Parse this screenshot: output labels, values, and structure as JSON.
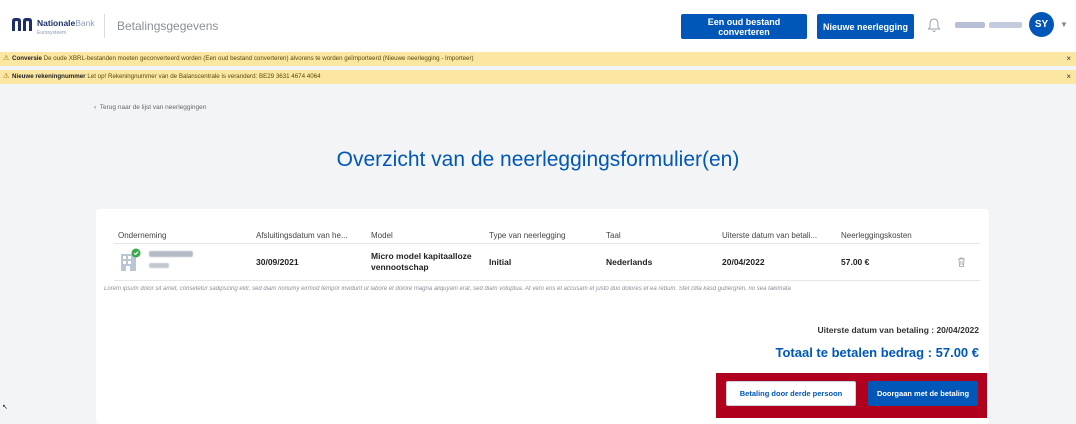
{
  "header": {
    "logo_name_bold": "Nationale",
    "logo_name_light": "Bank",
    "logo_sub": "Eurosysteem",
    "app_title": "Betalingsgegevens",
    "convert_button": "Een oud bestand converteren",
    "new_filing_button": "Nieuwe neerlegging",
    "avatar_initials": "SY",
    "colors": {
      "primary": "#0057b8",
      "alert_bg": "#fbe6a2",
      "highlight": "#b0001e"
    }
  },
  "alerts": [
    {
      "title": "Conversie",
      "text": "De oude XBRL-bestanden moeten geconverteerd worden (Een oud bestand converteren) alvorens te worden geïmporteerd (Nieuwe neerlegging - Importeer)",
      "close": "×"
    },
    {
      "title": "Nieuwe rekeningnummer",
      "text": "Let op! Rekeningnummer van de Balanscentrale is veranderd: BE29 3631 4674 4064",
      "close": "×"
    }
  ],
  "back_link": "Terug naar de lijst van neerleggingen",
  "page_title": "Overzicht van de neerleggingsformulier(en)",
  "table": {
    "columns": [
      "Onderneming",
      "Afsluitingsdatum van he...",
      "Model",
      "Type van neerlegging",
      "Taal",
      "Uiterste datum van betali...",
      "Neerleggingskosten"
    ],
    "row": {
      "closing_date": "30/09/2021",
      "model_line1": "Micro model kapitaalloze",
      "model_line2": "vennootschap",
      "type": "Initial",
      "language": "Nederlands",
      "due_date": "20/04/2022",
      "cost": "57.00 €"
    },
    "note": "Lorem ipsum dolor sit amet, consetetur sadipscing elitr, sed diam nonumy eirmod tempor invidunt ut labore et dolore magna aliquyam erat, sed diam voluptua. At vero eos et accusam et justo duo dolores et ea rebum. Stet clita kasd gubergren, no sea takimata"
  },
  "summary": {
    "due_line": "Uiterste datum van betaling : 20/04/2022",
    "total_line": "Totaal te betalen bedrag : 57.00 €"
  },
  "actions": {
    "third_party": "Betaling door derde persoon",
    "continue": "Doorgaan met de betaling"
  }
}
